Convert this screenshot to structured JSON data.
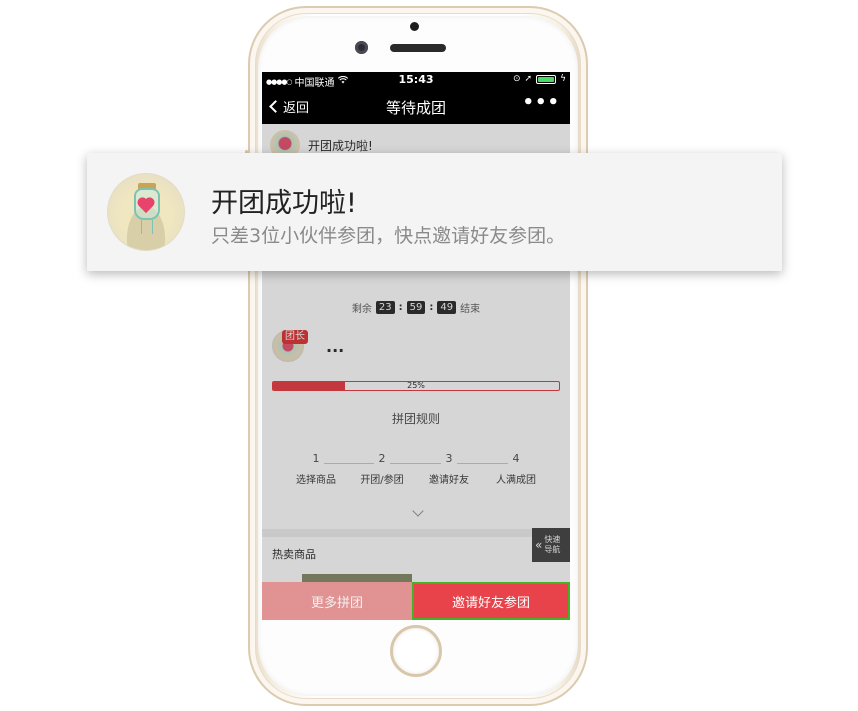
{
  "status_bar": {
    "carrier": "中国联通",
    "time": "15:43",
    "wifi_icon": "wifi-icon",
    "battery_color": "#4cd964"
  },
  "nav": {
    "back_label": "返回",
    "title": "等待成团",
    "more_label": "•••"
  },
  "notification": {
    "title": "开团成功啦!",
    "body": "只差3位小伙伴参团，快点邀请好友参团。"
  },
  "mini_notice": {
    "title": "开团成功啦!"
  },
  "countdown": {
    "prefix": "剩余",
    "hours": "23",
    "minutes": "59",
    "seconds": "49",
    "suffix": "结束"
  },
  "leader": {
    "badge": "团长",
    "more": "..."
  },
  "progress": {
    "label": "25%",
    "value": 0.25,
    "color": "#e8434a"
  },
  "rules": {
    "title": "拼团规则",
    "steps": [
      {
        "num": "1",
        "label": "选择商品"
      },
      {
        "num": "2",
        "label": "开团/参团"
      },
      {
        "num": "3",
        "label": "邀请好友"
      },
      {
        "num": "4",
        "label": "人满成团"
      }
    ]
  },
  "quick_nav": {
    "line1": "快速",
    "line2": "导航"
  },
  "hot": {
    "title": "热卖商品"
  },
  "bottom": {
    "more_label": "更多拼团",
    "invite_label": "邀请好友参团",
    "accent": "#e8434a",
    "highlight": "#48b027"
  }
}
